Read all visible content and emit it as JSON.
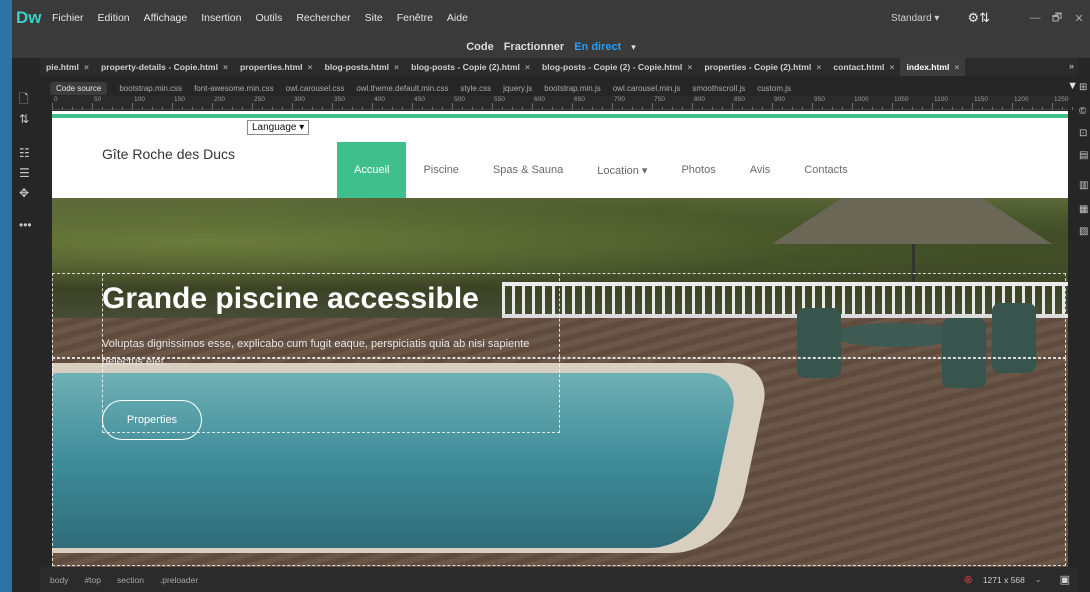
{
  "app": {
    "logo": "Dw",
    "menu": [
      "Fichier",
      "Edition",
      "Affichage",
      "Insertion",
      "Outils",
      "Rechercher",
      "Site",
      "Fenêtre",
      "Aide"
    ],
    "workspace": "Standard",
    "workspace_caret": "▾",
    "sync_icon": "⚙⇅",
    "window_buttons": [
      "—",
      "🗗",
      "✕"
    ]
  },
  "viewbar": {
    "code": "Code",
    "split": "Fractionner",
    "live": "En direct",
    "caret": "▾"
  },
  "tabs": [
    {
      "label": "pie.html",
      "close": "×"
    },
    {
      "label": "property-details - Copie.html",
      "close": "×"
    },
    {
      "label": "properties.html",
      "close": "×"
    },
    {
      "label": "blog-posts.html",
      "close": "×"
    },
    {
      "label": "blog-posts - Copie (2).html",
      "close": "×"
    },
    {
      "label": "blog-posts - Copie (2) - Copie.html",
      "close": "×"
    },
    {
      "label": "properties - Copie (2).html",
      "close": "×"
    },
    {
      "label": "contact.html",
      "close": "×"
    },
    {
      "label": "index.html",
      "close": "×",
      "active": true
    }
  ],
  "tabs_more": "»",
  "related_files": {
    "source": "Code source",
    "files": [
      "bootstrap.min.css",
      "font-awesome.min.css",
      "owl.carousel.css",
      "owl.theme.default.min.css",
      "style.css",
      "jquery.js",
      "bootstrap.min.js",
      "owl.carousel.min.js",
      "smoothscroll.js",
      "custom.js"
    ],
    "filter_icon": "▼"
  },
  "ruler_labels": [
    "0",
    "50",
    "100",
    "150",
    "200",
    "250",
    "300",
    "350",
    "400",
    "450",
    "500",
    "550",
    "600",
    "650",
    "700",
    "750",
    "800",
    "850",
    "900",
    "950",
    "1000",
    "1050",
    "1100",
    "1150",
    "1200",
    "1250"
  ],
  "site": {
    "language": "Language ▾",
    "brand": "Gîte Roche des Ducs",
    "nav": [
      "Accueil",
      "Piscine",
      "Spas & Sauna",
      "Location ▾",
      "Photos",
      "Avis",
      "Contacts"
    ],
    "hero_title": "Grande piscine accessible",
    "hero_sub": "Voluptas dignissimos esse, explicabo cum fugit eaque, perspiciatis quia ab nisi sapiente delectus eiet.",
    "hero_button": "Properties"
  },
  "statusbar": {
    "tags": [
      "body",
      "#top",
      "section",
      ".preloader"
    ],
    "error_icon": "⊗",
    "dimensions": "1271 x 568",
    "caret": "⌄",
    "device_icon": "▣"
  },
  "left_tools": [
    "🗋",
    "⇅",
    "☷",
    "☰",
    "✥",
    "•••"
  ],
  "right_tools": [
    "⊞",
    "©",
    "⊡",
    "▤",
    "▥",
    "▦",
    "▧"
  ],
  "colors": {
    "accent": "#3fbf8c",
    "live": "#2b9bf0",
    "logo": "#3bd1c6"
  }
}
